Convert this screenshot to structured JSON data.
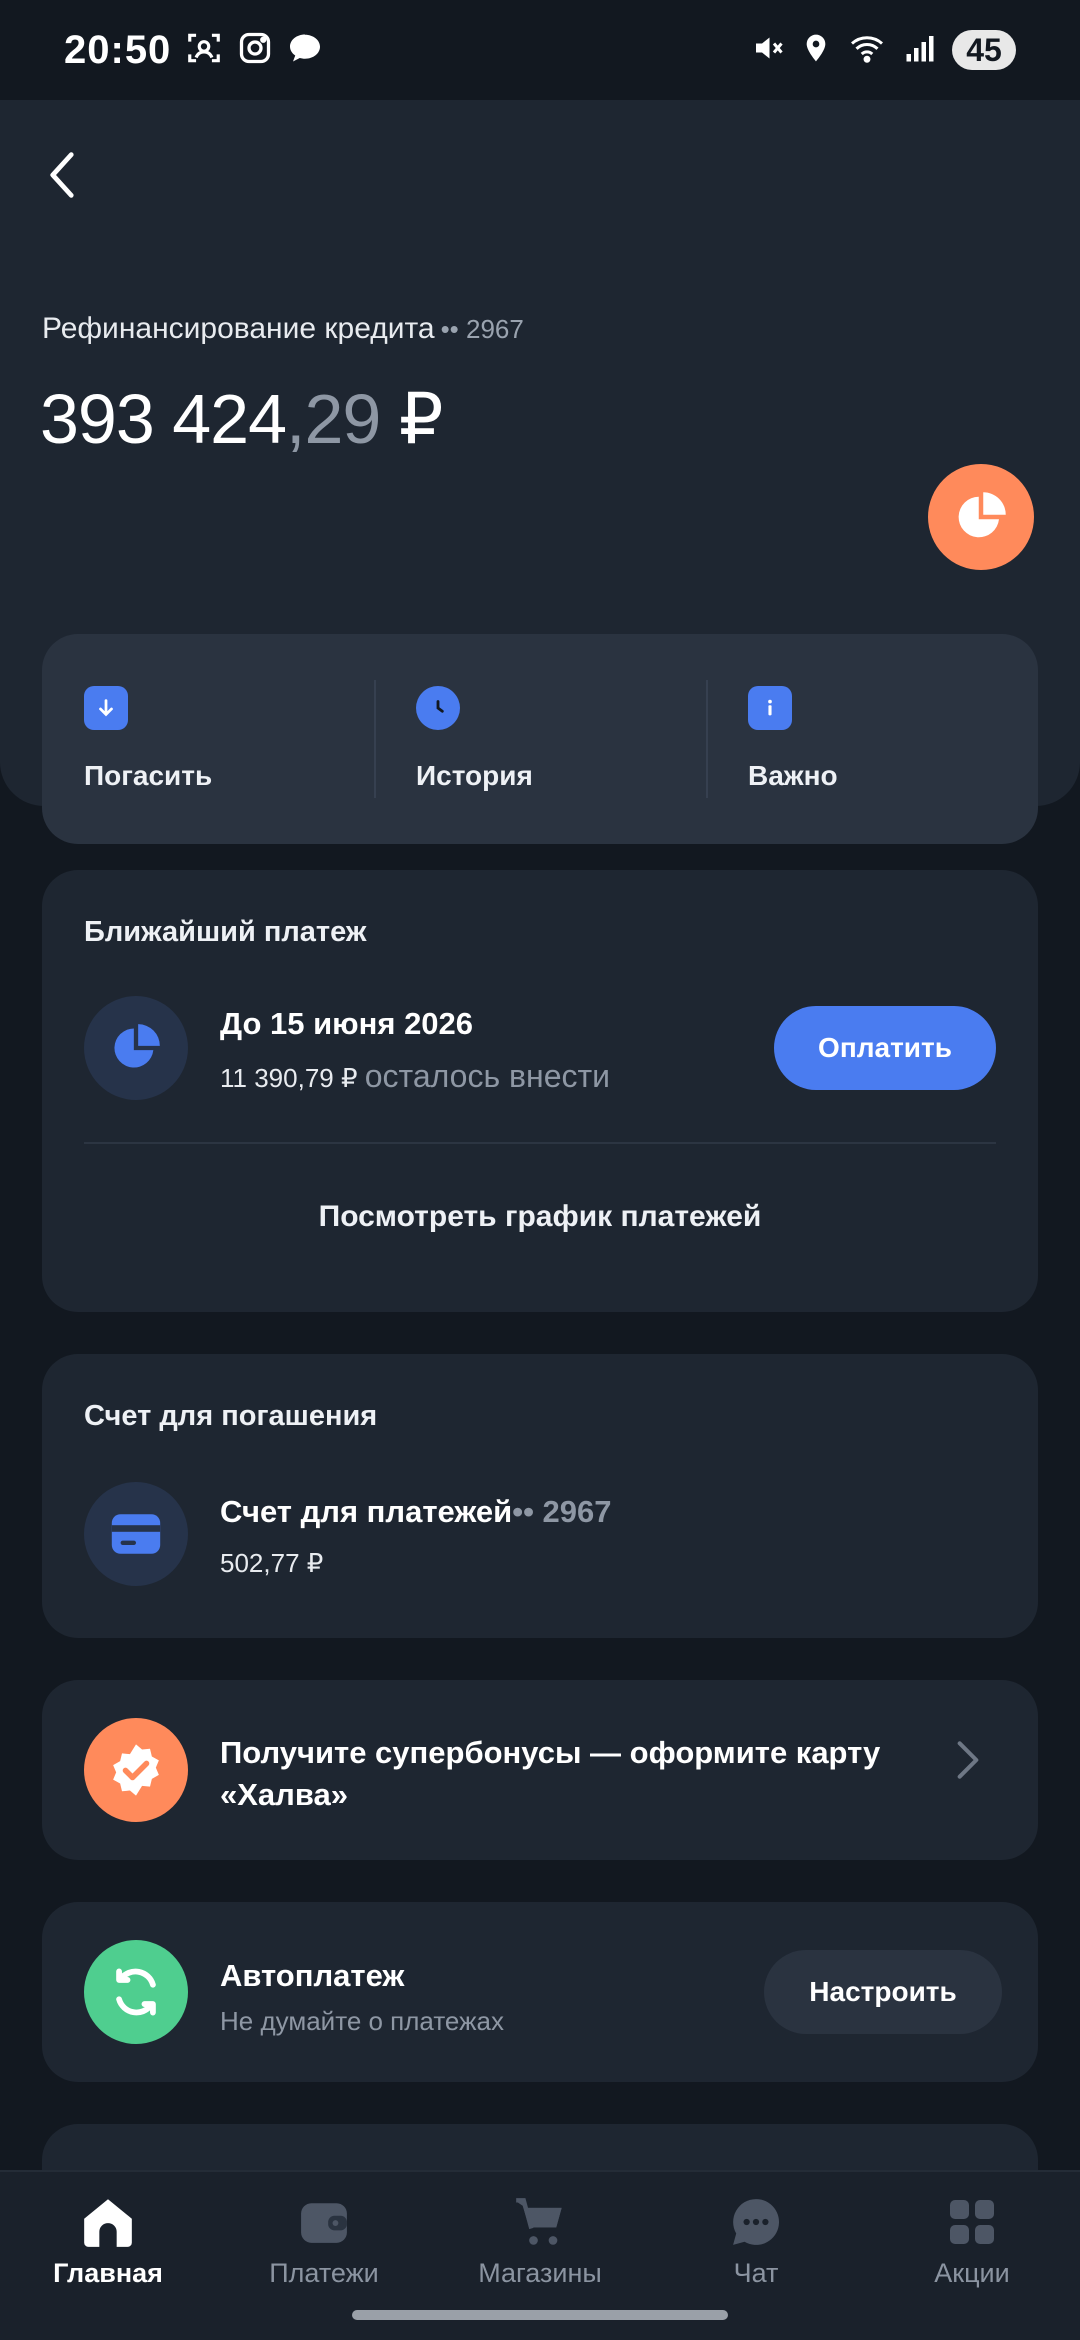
{
  "status_bar": {
    "time": "20:50",
    "battery": "45"
  },
  "header": {
    "account_name": "Рефинансирование кредита",
    "account_mask": "•• 2967",
    "balance_whole": "393 424",
    "balance_fraction": ",29",
    "currency": "₽"
  },
  "actions": [
    {
      "label": "Погасить"
    },
    {
      "label": "История"
    },
    {
      "label": "Важно"
    }
  ],
  "next_payment": {
    "title": "Ближайший платеж",
    "due": "До 15 июня 2026",
    "amount": "11 390,79 ₽",
    "amount_note": "осталось внести",
    "pay_label": "Оплатить",
    "schedule_label": "Посмотреть график платежей"
  },
  "repayment_account": {
    "title": "Счет для погашения",
    "name": "Счет для платежей",
    "mask": "•• 2967",
    "balance": "502,77 ₽"
  },
  "promo": {
    "line1": "Получите супербонусы — оформите карту",
    "line2": "«Халва»"
  },
  "autopay": {
    "title": "Автоплатеж",
    "subtitle": "Не думайте о платежах",
    "button_label": "Настроить"
  },
  "bottom_nav": [
    {
      "label": "Главная",
      "active": true
    },
    {
      "label": "Платежи"
    },
    {
      "label": "Магазины"
    },
    {
      "label": "Чат"
    },
    {
      "label": "Акции"
    }
  ],
  "colors": {
    "accent_blue": "#4a7cf0",
    "accent_orange": "#ff8a5b",
    "accent_green": "#4fce8f",
    "background": "#121820",
    "card": "#1e2631"
  }
}
